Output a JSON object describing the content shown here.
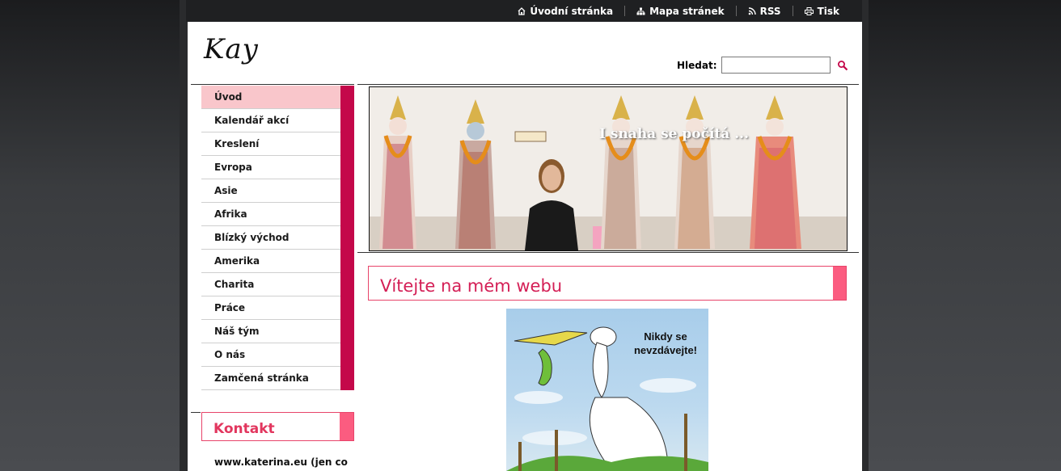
{
  "topnav": {
    "items": [
      {
        "label": "Úvodní stránka",
        "icon": "home-icon"
      },
      {
        "label": "Mapa stránek",
        "icon": "sitemap-icon"
      },
      {
        "label": "RSS",
        "icon": "rss-icon"
      },
      {
        "label": "Tisk",
        "icon": "print-icon"
      }
    ]
  },
  "logo": {
    "text": "Kay"
  },
  "search": {
    "label": "Hledat:",
    "value": "",
    "button_icon": "search-icon"
  },
  "menu": {
    "items": [
      {
        "label": "Úvod",
        "active": true
      },
      {
        "label": "Kalendář akcí"
      },
      {
        "label": "Kreslení"
      },
      {
        "label": "Evropa"
      },
      {
        "label": "Asie"
      },
      {
        "label": "Afrika"
      },
      {
        "label": "Blízký východ"
      },
      {
        "label": "Amerika"
      },
      {
        "label": "Charita"
      },
      {
        "label": "Práce"
      },
      {
        "label": "Náš tým"
      },
      {
        "label": "O nás"
      },
      {
        "label": "Zamčená stránka"
      }
    ]
  },
  "contact": {
    "heading": "Kontakt",
    "text": "www.katerina.eu (jen co"
  },
  "banner": {
    "caption": "I snaha se počítá ..."
  },
  "main": {
    "welcome_heading": "Vítejte na mém webu",
    "cartoon_text": "Nikdy se nevzdávejte!"
  },
  "colors": {
    "accent": "#c4084a",
    "accent_light": "#fb5c80",
    "active_bg": "#f9c6cb",
    "heading": "#d41f56"
  }
}
